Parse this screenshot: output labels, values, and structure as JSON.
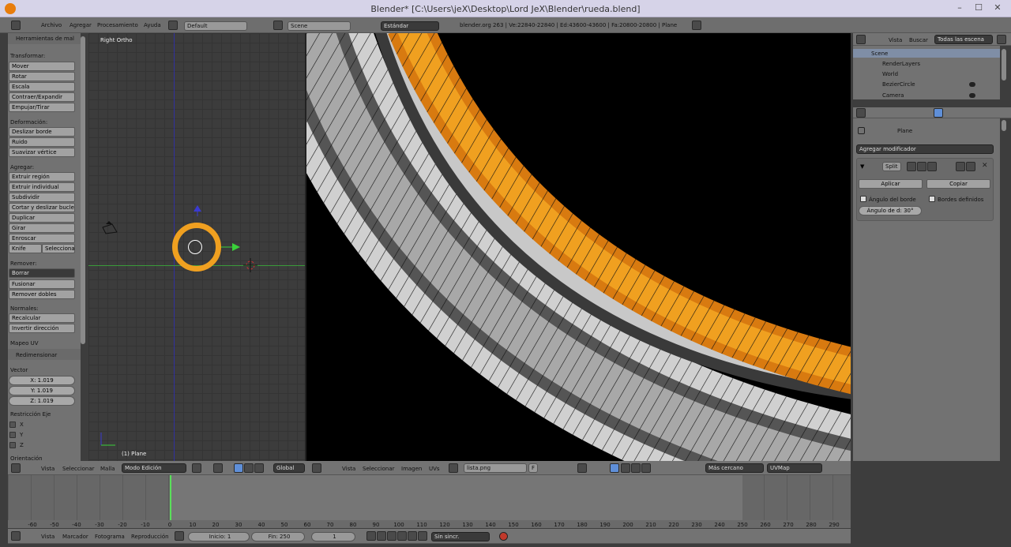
{
  "window": {
    "title": "Blender* [C:\\Users\\jeX\\Desktop\\Lord JeX\\Blender\\rueda.blend]",
    "min": "–",
    "max": "☐",
    "close": "✕"
  },
  "info_header": {
    "menus": [
      "Archivo",
      "Agregar",
      "Procesamiento",
      "Ayuda"
    ],
    "layout": "Default",
    "scene": "Scene",
    "engine": "Estándar",
    "stats": "blender.org 263 | Ve:22840-22840 | Ed:43600-43600 | Fa:20800-20800 | Plane"
  },
  "tool_shelf": {
    "title": "Herramientas de mal",
    "transform_header": "Transformar:",
    "transform": [
      "Mover",
      "Rotar",
      "Escala",
      "Contraer/Expandir",
      "Empujar/Tirar"
    ],
    "deform_header": "Deformación:",
    "deform": [
      "Deslizar borde",
      "Ruido",
      "Suavizar vértice"
    ],
    "add_header": "Agregar:",
    "add": [
      "Extruir región",
      "Extruir individual",
      "Subdividir",
      "Cortar y deslizar bucle",
      "Duplicar",
      "Girar",
      "Enroscar"
    ],
    "knife": "Knife",
    "select": "Seleccionar",
    "remove_header": "Remover:",
    "delete": "Borrar",
    "merge": "Fusionar",
    "remove_doubles": "Remover dobles",
    "normals_header": "Normales:",
    "recalc": "Recalcular",
    "flip": "Invertir dirección",
    "uv_header": "Mapeo UV",
    "resize_header": "Redimensionar",
    "vector_label": "Vector",
    "x": "X: 1.019",
    "y": "Y: 1.019",
    "z": "Z: 1.019",
    "constraint_label": "Restricción Eje",
    "ax": "X",
    "ay": "Y",
    "az": "Z",
    "orientation": "Orientación"
  },
  "viewport": {
    "label": "Right Ortho",
    "object": "(1) Plane"
  },
  "view3d_header": {
    "menus": [
      "Vista",
      "Seleccionar",
      "Malla"
    ],
    "mode": "Modo Edición",
    "orientation": "Global"
  },
  "uv_header": {
    "menus": [
      "Vista",
      "Seleccionar",
      "Imagen",
      "UVs"
    ],
    "image": "lista.png",
    "f": "F",
    "sampling": "Más cercano",
    "uvmap": "UVMap"
  },
  "outliner_header": {
    "view": "Vista",
    "search": "Buscar",
    "filter": "Todas las escena"
  },
  "outliner": [
    {
      "name": "Scene",
      "sel": true
    },
    {
      "name": "RenderLayers"
    },
    {
      "name": "World"
    },
    {
      "name": "BezierCircle"
    },
    {
      "name": "Camera"
    }
  ],
  "properties": {
    "object": "Plane",
    "add_modifier": "Agregar modificador",
    "mod_name": "Split",
    "apply": "Aplicar",
    "copy": "Copiar",
    "edge_angle": "Ángulo del borde",
    "sharp_edges": "Bordes definidos",
    "split_angle": "Ángulo de d: 30°"
  },
  "timeline": {
    "ticks": [
      "-60",
      "-50",
      "-40",
      "-30",
      "-20",
      "-10",
      "0",
      "10",
      "20",
      "30",
      "40",
      "50",
      "60",
      "70",
      "80",
      "90",
      "100",
      "110",
      "120",
      "130",
      "140",
      "150",
      "160",
      "170",
      "180",
      "190",
      "200",
      "210",
      "220",
      "230",
      "240",
      "250",
      "260",
      "270",
      "280",
      "290"
    ],
    "menus": [
      "Vista",
      "Marcador",
      "Fotograma",
      "Reproducción"
    ],
    "start": "Inicio: 1",
    "end": "Fin: 250",
    "current": "1",
    "sync": "Sin sincr."
  },
  "colors": {
    "accent": "#f0a020",
    "selected": "#5f8fd8",
    "grid": "#3c3c3c"
  }
}
